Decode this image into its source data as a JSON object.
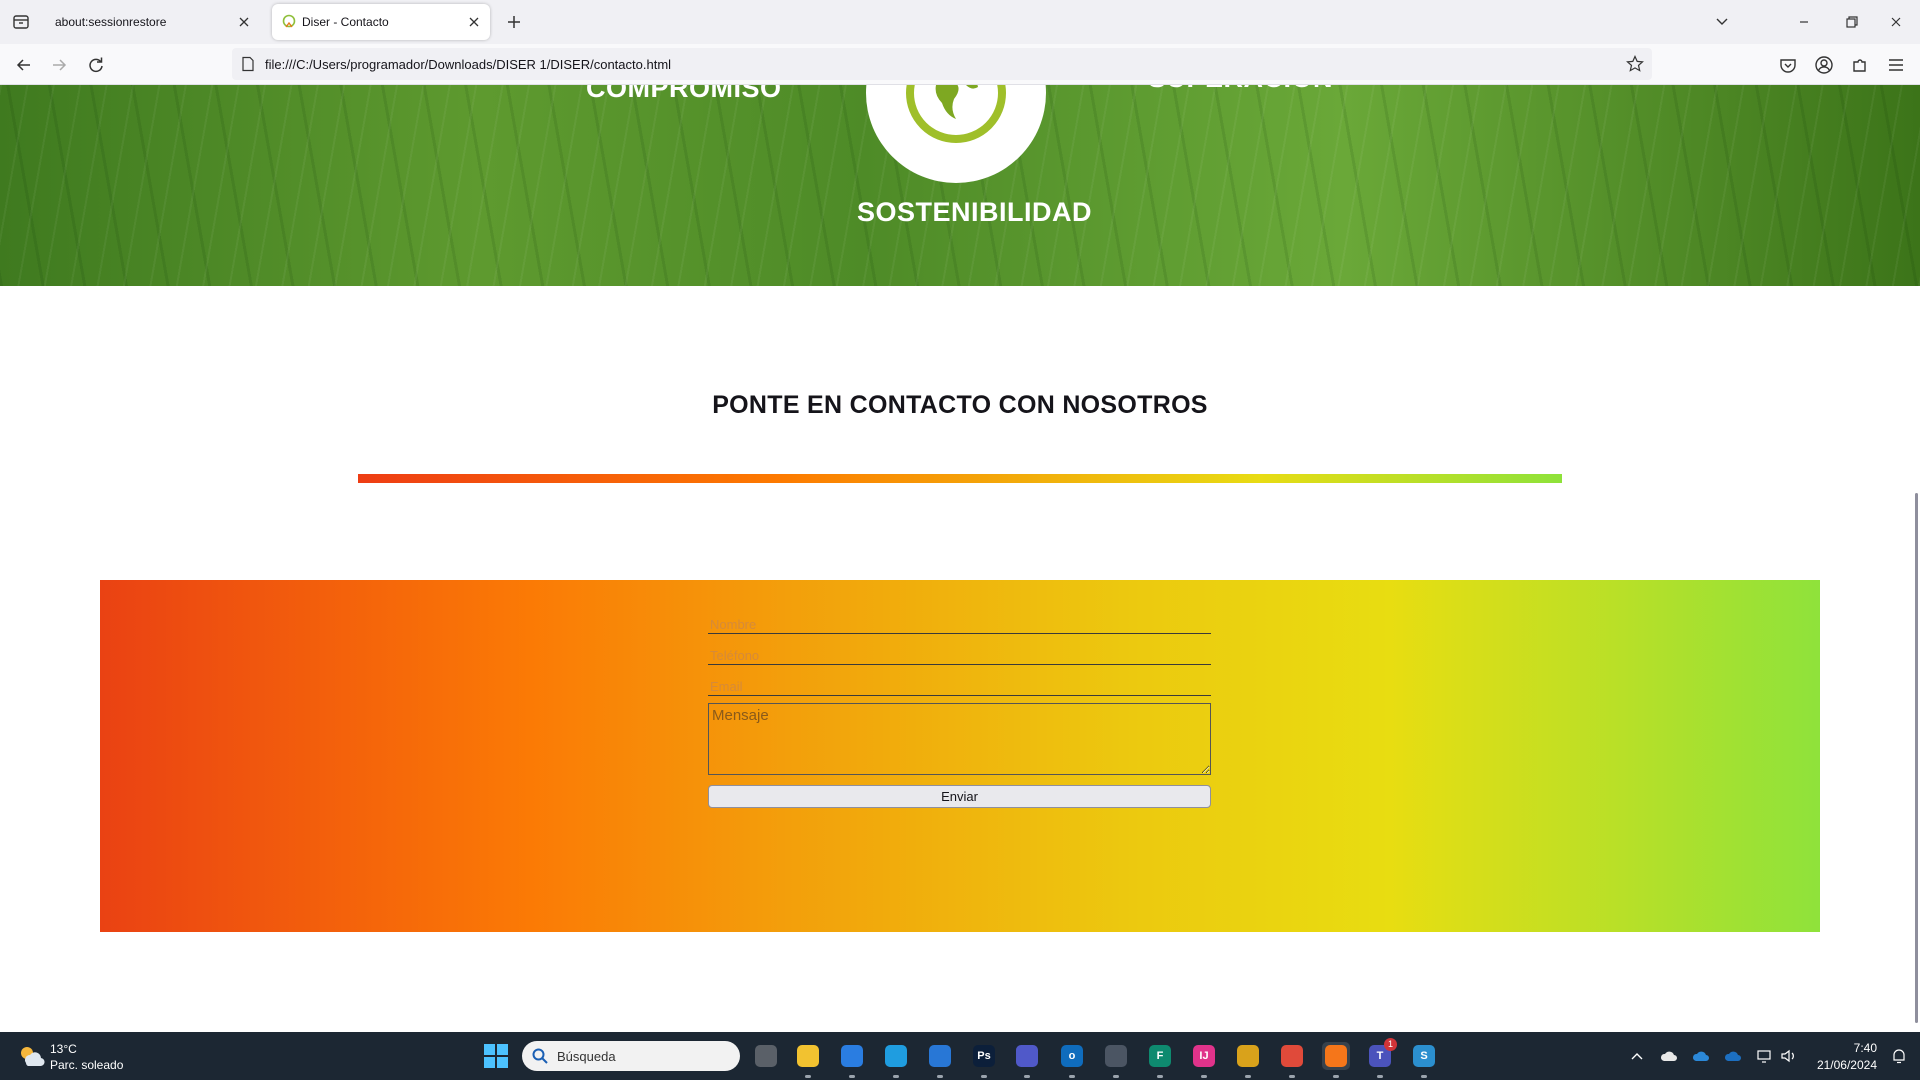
{
  "browser": {
    "tabs": [
      {
        "title": "about:sessionrestore"
      },
      {
        "title": "Diser - Contacto"
      }
    ],
    "url": "file:///C:/Users/programador/Downloads/DISER 1/DISER/contacto.html"
  },
  "hero": {
    "words": {
      "compromiso": "COMPROMISO",
      "superacion": "SUPERACIÓN",
      "sostenibilidad": "SOSTENIBILIDAD"
    }
  },
  "contact": {
    "title": "PONTE EN CONTACTO CON NOSOTROS",
    "gradient_colors": [
      "#ee3d14",
      "#fd7a00",
      "#e8dc14",
      "#8ee23a"
    ],
    "form": {
      "name_placeholder": "Nombre",
      "phone_placeholder": "Teléfono",
      "email_placeholder": "Email",
      "message_placeholder": "Mensaje",
      "submit_label": "Enviar"
    }
  },
  "taskbar": {
    "weather": {
      "temp": "13°C",
      "desc": "Parc. soleado"
    },
    "search_placeholder": "Búsqueda",
    "apps": [
      {
        "name": "task-view",
        "color": "#5a6068"
      },
      {
        "name": "file-explorer",
        "color": "#f2c230"
      },
      {
        "name": "microsoft-store",
        "color": "#2a7de1"
      },
      {
        "name": "edge",
        "color": "#1f9de0"
      },
      {
        "name": "mail",
        "color": "#2877d6"
      },
      {
        "name": "photoshop",
        "color": "#0c1f3a",
        "letter": "Ps"
      },
      {
        "name": "teams",
        "color": "#5059c9"
      },
      {
        "name": "outlook",
        "color": "#0f6cbd",
        "letter": "o"
      },
      {
        "name": "calculator",
        "color": "#4b5563"
      },
      {
        "name": "fabric",
        "color": "#0e8a6f",
        "letter": "F"
      },
      {
        "name": "intellij",
        "color": "#e0338b",
        "letter": "IJ"
      },
      {
        "name": "windows-apps",
        "color": "#d9a21b"
      },
      {
        "name": "chrome",
        "color": "#e04a3a"
      },
      {
        "name": "firefox",
        "color": "#f5761a"
      },
      {
        "name": "teams-new",
        "color": "#4b53bc",
        "letter": "T",
        "badge": "1"
      },
      {
        "name": "app-s",
        "color": "#2b8fcf",
        "letter": "S"
      }
    ],
    "time": "7:40",
    "date": "21/06/2024"
  }
}
